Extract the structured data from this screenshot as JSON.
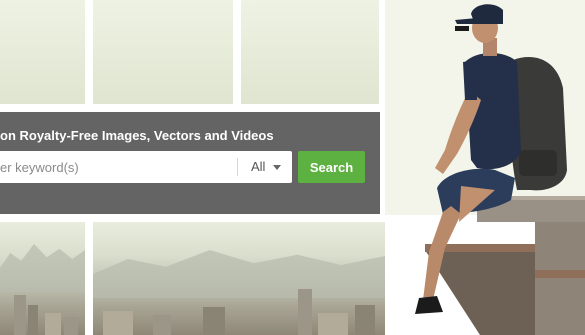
{
  "hero": {
    "headline": "on Royalty-Free Images, Vectors and Videos"
  },
  "search": {
    "placeholder": "er keyword(s)",
    "type_selected": "All",
    "button_label": "Search"
  },
  "colors": {
    "overlay": "#585858",
    "search_button": "#5db141",
    "backdrop_sky": "#eef2e3"
  },
  "icons": {
    "dropdown": "chevron-down-icon"
  }
}
